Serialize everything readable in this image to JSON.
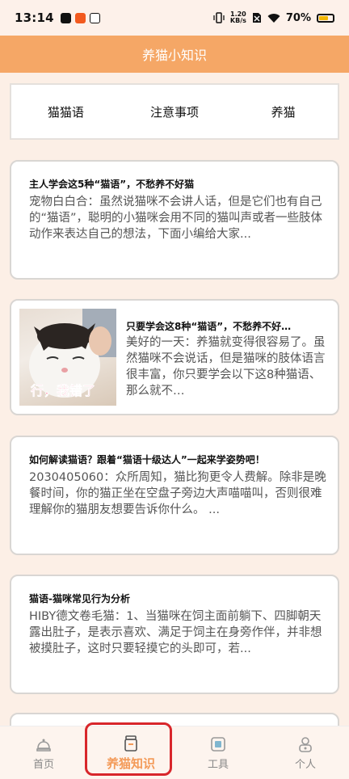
{
  "status": {
    "time": "13:14",
    "net_speed_top": "1.20",
    "net_speed_bottom": "KB/s",
    "battery": "70%"
  },
  "header": {
    "title": "养猫小知识"
  },
  "tabs": [
    {
      "label": "猫猫语"
    },
    {
      "label": "注意事项"
    },
    {
      "label": "养猫"
    }
  ],
  "articles": [
    {
      "title": "主人学会这5种“猫语”，不愁养不好猫",
      "body": "宠物白白合：虽然说猫咪不会讲人话，但是它们也有自己的“猫语”，聪明的小猫咪会用不同的猫叫声或者一些肢体动作来表达自己的想法，下面小编给大家..."
    },
    {
      "title": "只要学会这8种“猫语”，不愁养不好…",
      "body": "美好的一天：养猫就变得很容易了。虽然猫咪不会说话，但是猫咪的肢体语言很丰富，你只要学会以下这8种猫语、那么就不…",
      "image_caption": "行，我错了"
    },
    {
      "title": "如何解读猫语？跟着“猫语十级达人”一起来学姿势吧！",
      "body": "2030405060：众所周知，猫比狗更令人费解。除非是晚餐时间，你的猫正坐在空盘子旁边大声喵喵叫，否则很难理解你的猫朋友想要告诉你什么。 ..."
    },
    {
      "title": "猫语-猫咪常见行为分析",
      "body": "HIBY德文卷毛猫：1、当猫咪在饲主面前躺下、四脚朝天露出肚子，是表示喜欢、满足于饲主在身旁作伴，并非想被摸肚子，这时只要轻摸它的头即可，若..."
    }
  ],
  "bottom_nav": [
    {
      "label": "首页",
      "icon": "bell-icon"
    },
    {
      "label": "养猫知识",
      "icon": "jar-icon",
      "active": true
    },
    {
      "label": "工具",
      "icon": "tool-icon"
    },
    {
      "label": "个人",
      "icon": "person-icon"
    }
  ],
  "colors": {
    "accent": "#f5a766",
    "active_tab": "#f39a58",
    "highlight": "#d8262b",
    "background": "#fcefe6"
  }
}
